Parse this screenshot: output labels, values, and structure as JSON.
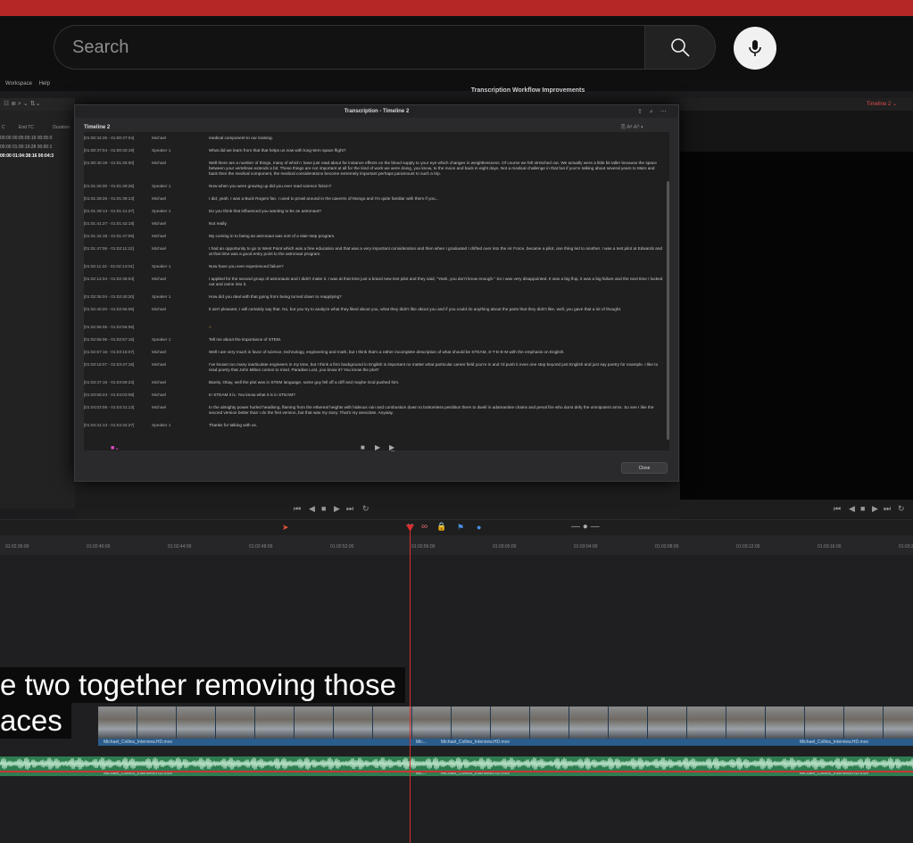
{
  "youtube": {
    "search_placeholder": "Search",
    "caption_line1": "e two together removing those",
    "caption_line2": "aces"
  },
  "resolve": {
    "menu": [
      "Workspace",
      "Help"
    ],
    "project_title": "Transcription Workflow Improvements",
    "timeline_name_right": "Timeline 2",
    "media_pool": {
      "columns": [
        "C",
        "End TC",
        "Duration"
      ],
      "rows": [
        "00:00  00:05:05:19  00:05:0",
        "00:00  01:00:19:28  00:00:1",
        "00:00  01:04:38:16  00:04:3"
      ]
    },
    "ruler_ticks": [
      "01:02:36:00",
      "01:02:40:00",
      "01:02:44:00",
      "01:02:48:00",
      "01:02:52:00",
      "01:02:56:00",
      "01:03:00:00",
      "01:03:04:00",
      "01:03:08:00",
      "01:03:12:00",
      "01:03:16:00",
      "01:03:20"
    ],
    "clip_name": "Michael_Collins_Interview.HD.mov",
    "clip_name_short": "Mic...",
    "transport_icons": [
      "⏮",
      "◀",
      "■",
      "▶",
      "⏭",
      "↻"
    ]
  },
  "dialog": {
    "title": "Transcription - Timeline 2",
    "subtitle": "Timeline 2",
    "close_label": "Close",
    "rows": [
      {
        "tc": "[01:00:34:26 - 01:00:37:04]",
        "speaker": "Michael",
        "text": "medical component to our training."
      },
      {
        "tc": "[01:00:37:04 - 01:00:40:19]",
        "speaker": "Speaker 1",
        "text": "What did we learn from that that helps us now with long-term space flight?"
      },
      {
        "tc": "[01:00:40:19 - 01:01:26:00]",
        "speaker": "Michael",
        "text": "Well there are a number of things, many of which I have just read about for instance effects on the blood supply to your eye which changes in weightlessness. Of course we felt stretched out. We actually were a little bit taller because the space between your vertebrae extends a bit. These things are not important at all for the kind of work we were doing, you know, to the moon and back in eight days. Not a medical challenge in that but if you're talking about several years to Mars and back then the medical component, the medical considerations become extremely important perhaps paramount to such a trip."
      },
      {
        "tc": "[01:01:26:00 - 01:01:28:26]",
        "speaker": "Speaker 1",
        "text": "Now when you were growing up did you ever read science fiction?"
      },
      {
        "tc": "[01:01:28:26 - 01:01:39:13]",
        "speaker": "Michael",
        "text": "I did, yeah. I was a Buck Rogers fan. I used to prowl around in the caverns of Mongo and I'm quite familiar with them if you..."
      },
      {
        "tc": "[01:01:39:13 - 01:01:41:27]",
        "speaker": "Speaker 1",
        "text": "Do you think that influenced you wanting to be an astronaut?"
      },
      {
        "tc": "[01:01:41:27 - 01:01:42:18]",
        "speaker": "Michael",
        "text": "Not really."
      },
      {
        "tc": "[01:01:42:18 - 01:01:47:06]",
        "speaker": "Michael",
        "text": "My coming in to being an astronaut was sort of a stair-step program."
      },
      {
        "tc": "[01:01:47:06 - 01:02:11:22]",
        "speaker": "Michael",
        "text": "I had an opportunity to go to West Point which was a free education and that was a very important consideration and then when I graduated I drifted over into the Air Force, became a pilot, one thing led to another. I was a test pilot at Edwards and at that time was a good entry point to the astronaut program."
      },
      {
        "tc": "[01:02:11:22 - 01:02:14:04]",
        "speaker": "Speaker 1",
        "text": "Now have you ever experienced failure?"
      },
      {
        "tc": "[01:02:14:04 - 01:02:36:04]",
        "speaker": "Michael",
        "text": "I applied for the second group of astronauts and I didn't make it. I was at that time just a brand new test pilot and they said, \"Yeah, you don't know enough.\" So I was very disappointed. It was a big flop, it was a big failure and the next time I lucked out and came into it."
      },
      {
        "tc": "[01:02:36:04 - 01:02:40:20]",
        "speaker": "Speaker 1",
        "text": "How did you deal with that going from being turned down to reapplying?"
      },
      {
        "tc": "[01:02:40:20 - 01:02:56:05]",
        "speaker": "Michael",
        "text": "It ain't pleasant, I will certainly say that. No, but you try to analyze what they liked about you, what they didn't like about you and if you could do anything about the parts that they didn't like, well, you gave that a lot of thought."
      },
      {
        "tc": "[01:02:56:05 - 01:02:56:06]",
        "speaker": "",
        "text": ""
      },
      {
        "tc": "[01:02:56:06 - 01:02:57:16]",
        "speaker": "Speaker 1",
        "text": "Tell me about the importance of STEM."
      },
      {
        "tc": "[01:02:57:16 - 01:03:15:07]",
        "speaker": "Michael",
        "text": "Well I am very much in favor of science, technology, engineering and math, but I think that's a rather incomplete description of what should be STEAM, S-T-E-E-M with the emphasis on English."
      },
      {
        "tc": "[01:03:15:07 - 01:03:47:16]",
        "speaker": "Michael",
        "text": "I've known too many inarticulate engineers in my time, but I think a firm background in English is important no matter what particular career field you're in and I'd push it even one step beyond just English and just say poetry for example. I like to read poetry that John Milton comes to mind. Paradise Lost, you know it? You know the plot?"
      },
      {
        "tc": "[01:03:47:16 - 01:03:59:23]",
        "speaker": "Michael",
        "text": "Barely. Okay, well the plot was in STEM language, some guy fell off a cliff and maybe God pushed him."
      },
      {
        "tc": "[01:03:59:23 - 01:04:03:08]",
        "speaker": "Michael",
        "text": "In STEAM it is. You know what it is in STEAM?"
      },
      {
        "tc": "[01:04:03:08 - 01:04:31:13]",
        "speaker": "Michael",
        "text": "In the almighty power hurled headlong, flaming from the ethereal heights with hideous ruin and combustion down to bottomless perdition there to dwell in adamantine chains and penal fire who durst defy the omnipotent arms. So see I like the second version better than I do the first version, but that was my story. That's my anecdote. Anyway."
      },
      {
        "tc": "[01:04:31:13 - 01:04:32:27]",
        "speaker": "Speaker 1",
        "text": "Thanks for talking with us."
      }
    ]
  }
}
